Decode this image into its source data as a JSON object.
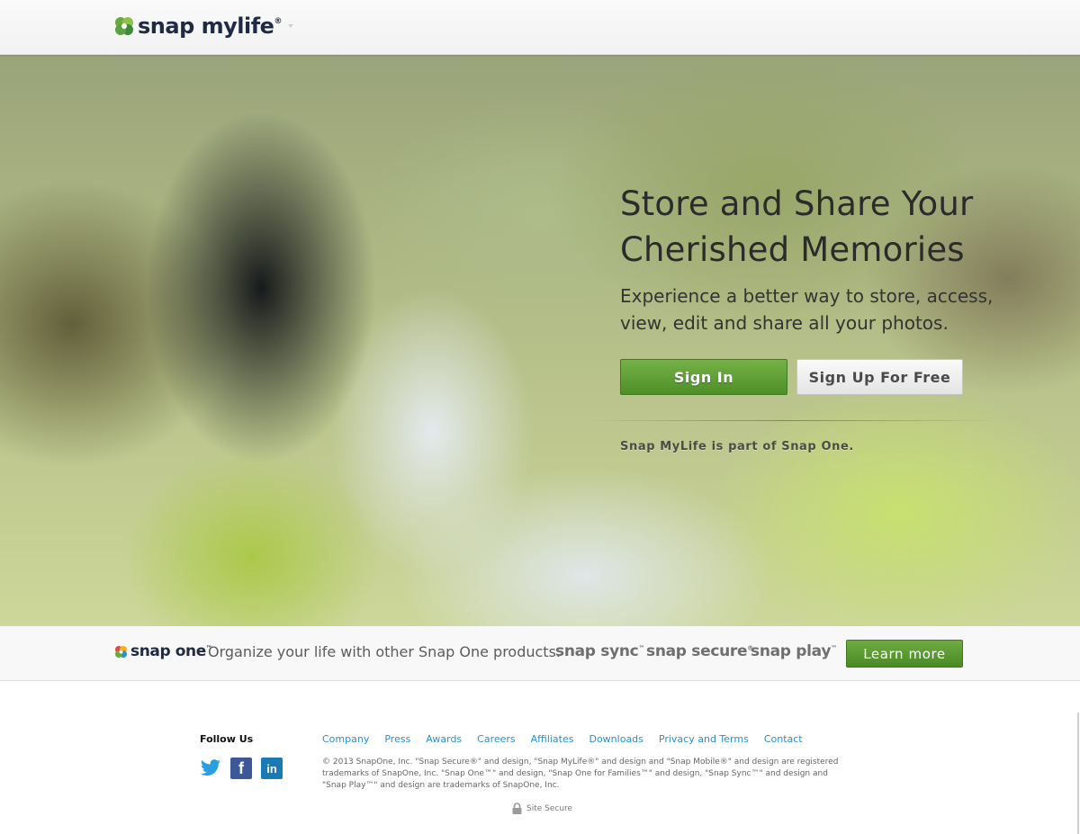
{
  "header": {
    "logo_text": "snap mylife",
    "logo_reg": "®"
  },
  "hero": {
    "title_line1": "Store and Share Your",
    "title_line2": "Cherished Memories",
    "subtitle_line1": "Experience a better way to store, access,",
    "subtitle_line2": "view, edit and share all your photos.",
    "signin_label": "Sign In",
    "signup_label": "Sign Up For Free",
    "note": "Snap MyLife is part of Snap One."
  },
  "products_bar": {
    "logo_text": "snap one",
    "logo_tm": "™",
    "tagline": "Organize your life with other Snap One products.",
    "products": [
      {
        "name": "snap sync",
        "mark": "™"
      },
      {
        "name": "snap secure",
        "mark": "®"
      },
      {
        "name": "snap play",
        "mark": "™"
      }
    ],
    "learn_more_label": "Learn more"
  },
  "footer": {
    "follow_title": "Follow Us",
    "social_icons": [
      "twitter-icon",
      "facebook-icon",
      "linkedin-icon"
    ],
    "facebook_glyph": "f",
    "linkedin_glyph": "in",
    "links": [
      "Company",
      "Press",
      "Awards",
      "Careers",
      "Affiliates",
      "Downloads",
      "Privacy and Terms",
      "Contact"
    ],
    "copyright": "© 2013 SnapOne, Inc. \"Snap Secure®\" and design, \"Snap MyLife®\" and design and \"Snap Mobile®\" and design are registered trademarks of SnapOne, Inc. \"Snap One™\" and design, \"Snap One for Families™\" and design, \"Snap Sync™\" and design and \"Snap Play™\" and design are trademarks of SnapOne, Inc.",
    "site_secure": "Site Secure"
  },
  "colors": {
    "primary_green": "#5a9a30",
    "link_blue": "#2a8fd0",
    "brand_navy": "#1f2a44"
  }
}
